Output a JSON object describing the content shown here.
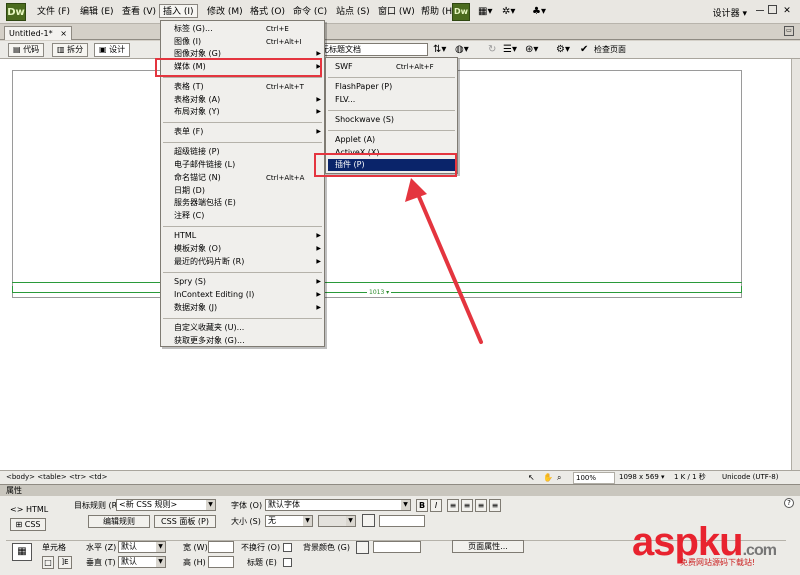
{
  "app": {
    "logo": "Dw",
    "workspace": "设计器 ▾"
  },
  "menubar": {
    "items": [
      "文件 (F)",
      "编辑 (E)",
      "查看 (V)",
      "插入 (I)",
      "修改 (M)",
      "格式 (O)",
      "命令 (C)",
      "站点 (S)",
      "窗口 (W)",
      "帮助 (H)"
    ],
    "active_index": 3
  },
  "document": {
    "tab_name": "Untitled-1*",
    "tab_close": "×"
  },
  "doc_toolbar": {
    "code_label": "代码",
    "split_label": "拆分",
    "design_label": "设计",
    "title_value": "无标题文档",
    "check_page_label": "检查页面"
  },
  "insert_menu": {
    "items": [
      {
        "label": "标签 (G)...",
        "shortcut": "Ctrl+E"
      },
      {
        "label": "图像 (I)",
        "shortcut": "Ctrl+Alt+I"
      },
      {
        "label": "图像对象 (G)",
        "shortcut": ""
      },
      {
        "label": "媒体 (M)",
        "shortcut": ""
      },
      {
        "label": "表格 (T)",
        "shortcut": "Ctrl+Alt+T"
      },
      {
        "label": "表格对象 (A)",
        "shortcut": ""
      },
      {
        "label": "布局对象 (Y)",
        "shortcut": ""
      },
      {
        "label": "表单 (F)",
        "shortcut": ""
      },
      {
        "label": "超级链接 (P)",
        "shortcut": ""
      },
      {
        "label": "电子邮件链接 (L)",
        "shortcut": ""
      },
      {
        "label": "命名锚记 (N)",
        "shortcut": "Ctrl+Alt+A"
      },
      {
        "label": "日期 (D)",
        "shortcut": ""
      },
      {
        "label": "服务器端包括 (E)",
        "shortcut": ""
      },
      {
        "label": "注释 (C)",
        "shortcut": ""
      },
      {
        "label": "HTML",
        "shortcut": ""
      },
      {
        "label": "模板对象 (O)",
        "shortcut": ""
      },
      {
        "label": "最近的代码片断 (R)",
        "shortcut": ""
      },
      {
        "label": "Spry (S)",
        "shortcut": ""
      },
      {
        "label": "InContext Editing (I)",
        "shortcut": ""
      },
      {
        "label": "数据对象 (J)",
        "shortcut": ""
      },
      {
        "label": "自定义收藏夹 (U)...",
        "shortcut": ""
      },
      {
        "label": "获取更多对象 (G)...",
        "shortcut": ""
      }
    ]
  },
  "media_submenu": {
    "items": [
      {
        "label": "SWF",
        "shortcut": "Ctrl+Alt+F"
      },
      {
        "label": "FlashPaper (P)",
        "shortcut": ""
      },
      {
        "label": "FLV...",
        "shortcut": ""
      },
      {
        "label": "Shockwave (S)",
        "shortcut": ""
      },
      {
        "label": "Applet (A)",
        "shortcut": ""
      },
      {
        "label": "ActiveX (X)",
        "shortcut": ""
      },
      {
        "label": "插件 (P)",
        "shortcut": ""
      }
    ]
  },
  "canvas": {
    "table_width_label": "1013 ▾"
  },
  "statusbar": {
    "tag_path": "<body> <table> <tr> <td>",
    "zoom": "100%",
    "window_size": "1098 x 569 ▾",
    "file_size": "1 K / 1 秒",
    "encoding": "Unicode (UTF-8)"
  },
  "properties": {
    "header": "属性",
    "html_tab": "HTML",
    "css_tab": "CSS",
    "target_rule_label": "目标规则 (R)",
    "target_rule_value": "<新 CSS 规则>",
    "edit_rule_button": "编辑规则",
    "css_panel_button": "CSS 面板 (P)",
    "font_label": "字体 (O)",
    "font_value": "默认字体",
    "size_label": "大小 (S)",
    "size_value": "无",
    "bold": "B",
    "italic": "I",
    "cell_label": "单元格",
    "horz_label": "水平 (Z)",
    "horz_value": "默认",
    "vert_label": "垂直 (T)",
    "vert_value": "默认",
    "width_label": "宽 (W)",
    "height_label": "高 (H)",
    "nowrap_label": "不换行 (O)",
    "header_label": "标题 (E)",
    "bg_label": "背景颜色 (G)",
    "page_props_button": "页面属性..."
  },
  "watermark": {
    "brand": "aspku",
    "suffix": ".com",
    "tagline": "免费网站源码下载站!"
  }
}
